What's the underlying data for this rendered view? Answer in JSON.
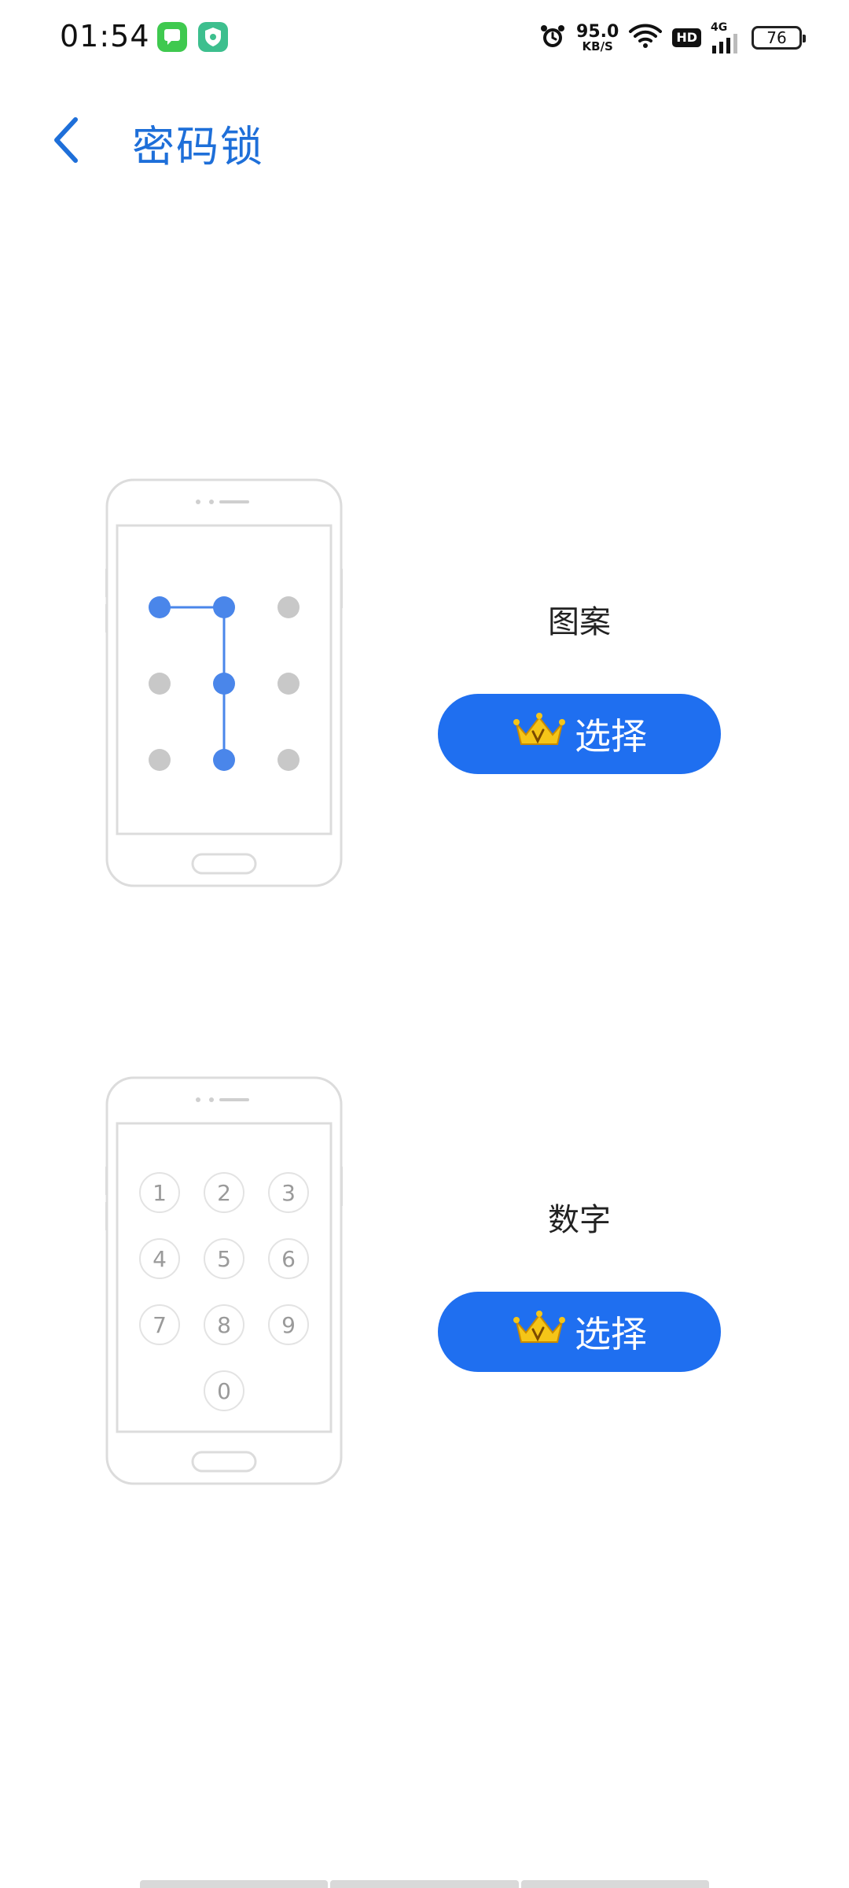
{
  "status_bar": {
    "time": "01:54",
    "net_speed_value": "95.0",
    "net_speed_unit": "KB/S",
    "network_type": "4G",
    "hd_label": "HD",
    "battery_level": "76"
  },
  "header": {
    "title": "密码锁"
  },
  "options": {
    "pattern": {
      "label": "图案",
      "button_label": "选择"
    },
    "pin": {
      "label": "数字",
      "button_label": "选择",
      "keypad_digits": [
        "1",
        "2",
        "3",
        "4",
        "5",
        "6",
        "7",
        "8",
        "9",
        "0"
      ]
    }
  },
  "colors": {
    "accent": "#1f6ff0",
    "title": "#1e6fd9",
    "pattern_active": "#4a86ea",
    "pattern_inactive": "#c8c8c8",
    "crown": "#f5c518"
  },
  "icons": {
    "back": "chevron-left-icon",
    "crown": "vip-crown-icon",
    "alarm": "alarm-icon",
    "wifi": "wifi-icon",
    "signal": "signal-icon"
  }
}
